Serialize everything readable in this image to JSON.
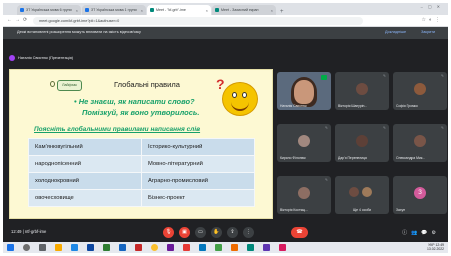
{
  "browser": {
    "tabs": [
      {
        "label": "ЗТ Українська мова 6 групи",
        "active": false
      },
      {
        "label": "ЗТ Українська мова 1 групи",
        "active": false
      },
      {
        "label": "Meet - \"kf-grb\"-ime",
        "active": true
      },
      {
        "label": "Meet - Захисний екран",
        "active": false
      }
    ],
    "url": "meet.google.com/kf-grbf-ime?pli=1&authuser=0"
  },
  "banner": {
    "text": "Деякі встановлені розширення можуть впливати на якість відеозв'язку",
    "btn_details": "Докладніше",
    "btn_close": "Закрити"
  },
  "presenter": {
    "label": "Наталія Свистюк (Презентація)"
  },
  "slide": {
    "badge": "Лайфхак",
    "title": "Глобальні правила",
    "bullet1": "• Не знаєш, як написати слово?",
    "bullet2": "Помізкуй, як воно утворилось.",
    "subtitle": "Поясніть глобальними правилами написання слів",
    "qmark": "?",
    "words": [
      [
        "Кам'янювугільний",
        "Історико-культурний"
      ],
      [
        "народнопісенний",
        "Мовно-літературний"
      ],
      [
        "холоднокровний",
        "Аграрно-промисловий"
      ],
      [
        "овочесховище",
        "Бізнес-проект"
      ]
    ]
  },
  "participants": [
    {
      "name": "Наталія Свистюк",
      "type": "video"
    },
    {
      "name": "Вікторія Шапурін...",
      "type": "avatar"
    },
    {
      "name": "Софія Громко",
      "type": "avatar"
    },
    {
      "name": "Кирило Філонюк",
      "type": "avatar"
    },
    {
      "name": "Дар'я Перепелиця",
      "type": "avatar"
    },
    {
      "name": "Олександра Мик...",
      "type": "avatar"
    },
    {
      "name": "Вікторія Костящ...",
      "type": "avatar"
    },
    {
      "name": "Ще 4 особи",
      "type": "group"
    },
    {
      "name": "Захуп",
      "type": "letter",
      "letter": "З"
    }
  ],
  "bottombar": {
    "time": "12:49",
    "meeting_code": "ntf-grbf-ime"
  },
  "taskbar": {
    "lang": "УКР",
    "clock_time": "12:49",
    "clock_date": "13.02.2022"
  }
}
